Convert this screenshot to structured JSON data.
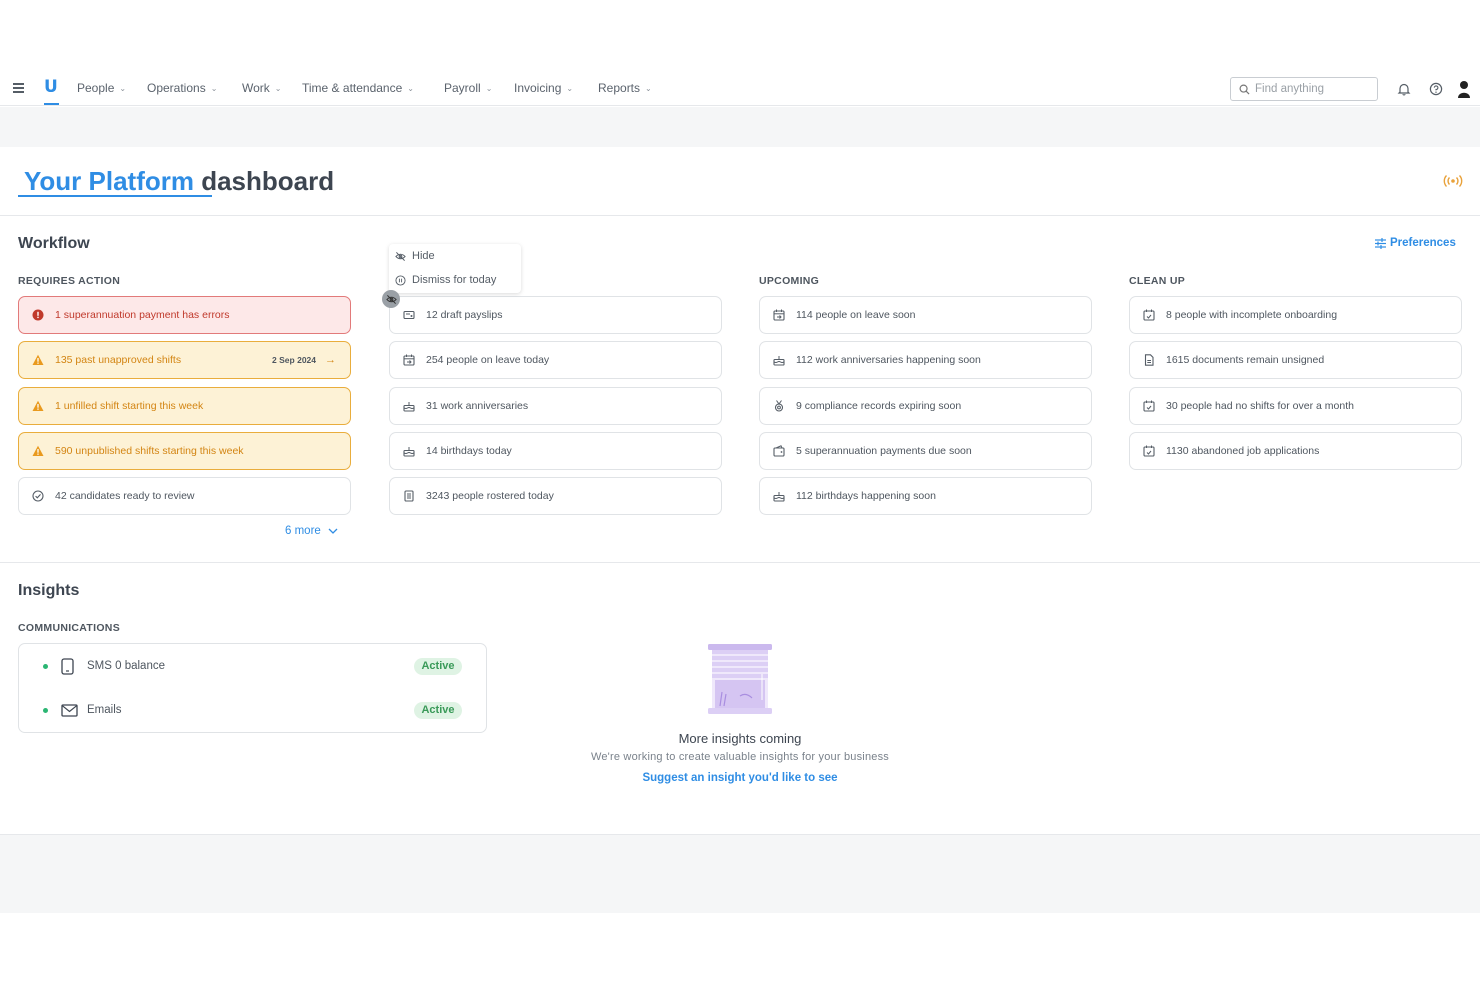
{
  "nav": {
    "items": [
      {
        "label": "People"
      },
      {
        "label": "Operations"
      },
      {
        "label": "Work"
      },
      {
        "label": "Time & attendance"
      },
      {
        "label": "Payroll"
      },
      {
        "label": "Invoicing"
      },
      {
        "label": "Reports"
      }
    ],
    "logo_text": "U",
    "search_placeholder": "Find anything"
  },
  "title": {
    "brand": "Your Platform",
    "rest": "dashboard"
  },
  "workflow": {
    "heading": "Workflow",
    "preferences_label": "Preferences",
    "columns": [
      {
        "header": "REQUIRES ACTION",
        "items": [
          {
            "text": "1 superannuation payment has errors",
            "status": "error"
          },
          {
            "text": "135 past unapproved shifts",
            "status": "warning",
            "date": "2 Sep 2024"
          },
          {
            "text": "1 unfilled shift starting this week",
            "status": "warning"
          },
          {
            "text": "590 unpublished shifts starting this week",
            "status": "warning"
          },
          {
            "text": "42 candidates ready to review",
            "status": "normal"
          }
        ],
        "more_label": "6 more"
      },
      {
        "header": "",
        "items": [
          {
            "text": "12 draft payslips"
          },
          {
            "text": "254 people on leave today"
          },
          {
            "text": "31 work anniversaries"
          },
          {
            "text": "14 birthdays today"
          },
          {
            "text": "3243 people rostered today"
          }
        ]
      },
      {
        "header": "UPCOMING",
        "items": [
          {
            "text": "114 people on leave soon"
          },
          {
            "text": "112 work anniversaries happening soon"
          },
          {
            "text": "9 compliance records expiring soon"
          },
          {
            "text": "5 superannuation payments due soon"
          },
          {
            "text": "112 birthdays happening soon"
          }
        ]
      },
      {
        "header": "CLEAN UP",
        "items": [
          {
            "text": "8 people with incomplete onboarding"
          },
          {
            "text": "1615 documents remain unsigned"
          },
          {
            "text": "30 people had no shifts for over a month"
          },
          {
            "text": "1130 abandoned job applications"
          }
        ]
      }
    ],
    "popover": {
      "hide": "Hide",
      "dismiss": "Dismiss for today"
    }
  },
  "insights": {
    "heading": "Insights",
    "communications_header": "COMMUNICATIONS",
    "channels": [
      {
        "label": "SMS 0 balance",
        "status": "Active"
      },
      {
        "label": "Emails",
        "status": "Active"
      }
    ],
    "empty_title": "More insights coming",
    "empty_subtitle": "We're working to create valuable insights for your business",
    "suggest_link": "Suggest an insight you'd like to see"
  },
  "colors": {
    "accent": "#2f8de4",
    "error": "#c0392b",
    "warning": "#d38513",
    "success": "#2bb673"
  }
}
